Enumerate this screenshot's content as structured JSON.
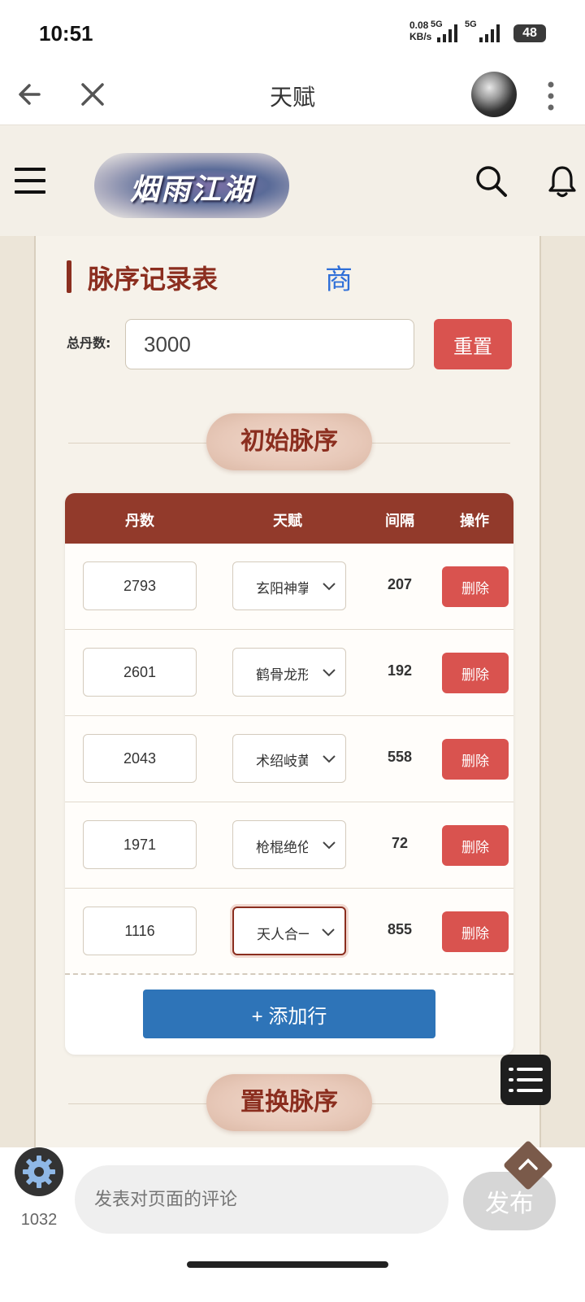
{
  "status_bar": {
    "time": "10:51",
    "net_speed_value": "0.08",
    "net_speed_unit": "KB/s",
    "signal1_label": "5G",
    "signal2_label": "5G",
    "battery": "48"
  },
  "nav": {
    "title": "天赋",
    "back_icon": "arrow-left-icon",
    "close_icon": "close-icon",
    "more_icon": "more-vertical-icon"
  },
  "header": {
    "logo_text": "烟雨江湖",
    "menu_icon": "hamburger-icon",
    "search_icon": "search-icon",
    "bell_icon": "bell-icon"
  },
  "page": {
    "section_title": "脉序记录表",
    "shang_link": "商",
    "total_label": "总丹数:",
    "total_value": "3000",
    "reset_label": "重置",
    "initial_pill": "初始脉序",
    "replace_pill": "置换脉序"
  },
  "table": {
    "headers": [
      "丹数",
      "天赋",
      "间隔",
      "操作"
    ],
    "rows": [
      {
        "dan": "2793",
        "talent": "玄阳神掌",
        "gap": "207",
        "action": "删除"
      },
      {
        "dan": "2601",
        "talent": "鹤骨龙形",
        "gap": "192",
        "action": "删除"
      },
      {
        "dan": "2043",
        "talent": "术绍岐黄",
        "gap": "558",
        "action": "删除"
      },
      {
        "dan": "1971",
        "talent": "枪棍绝伦",
        "gap": "72",
        "action": "删除"
      },
      {
        "dan": "1116",
        "talent": "天人合一",
        "gap": "855",
        "action": "删除"
      }
    ],
    "add_row_label": "+ 添加行"
  },
  "comment": {
    "placeholder": "发表对页面的评论",
    "publish_label": "发布",
    "count": "1032"
  },
  "colors": {
    "accent_red": "#8b2e1f",
    "table_header": "#923a2b",
    "danger": "#d9534f",
    "primary_blue": "#2e74b8",
    "link_blue": "#2f6fd8"
  }
}
